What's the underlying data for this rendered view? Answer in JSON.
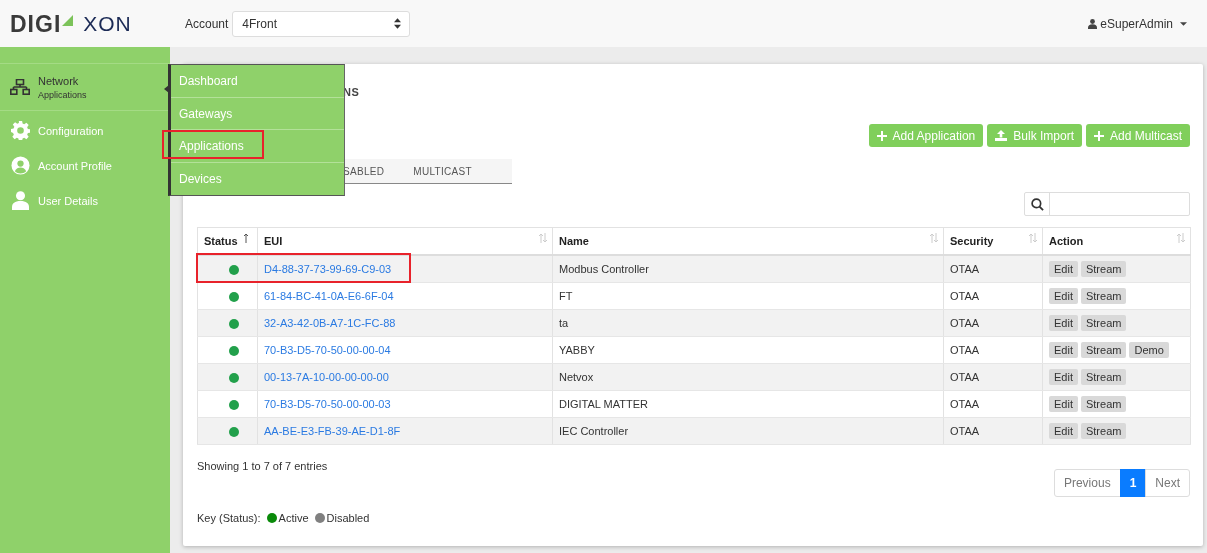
{
  "header": {
    "logo": {
      "left": "DIGI",
      "right": "XON"
    },
    "account_label": "Account",
    "account_value": "4Front",
    "user": "eSuperAdmin"
  },
  "sidebar": {
    "items": [
      {
        "label": "Network",
        "sublabel": "Applications",
        "selected": true
      },
      {
        "label": "Configuration",
        "selected": false
      },
      {
        "label": "Account Profile",
        "selected": false
      },
      {
        "label": "User Details",
        "selected": false
      }
    ]
  },
  "flyout_menu": {
    "items": [
      {
        "label": "Dashboard",
        "highlighted": false
      },
      {
        "label": "Gateways",
        "highlighted": false
      },
      {
        "label": "Applications",
        "highlighted": true
      },
      {
        "label": "Devices",
        "highlighted": false
      }
    ]
  },
  "page_title": "NS",
  "buttons": [
    {
      "label": "Add Application"
    },
    {
      "label": "Bulk Import"
    },
    {
      "label": "Add Multicast"
    }
  ],
  "tabs": [
    {
      "label": "SABLED",
      "selected": false
    },
    {
      "label": "MULTICAST",
      "selected": false
    }
  ],
  "table": {
    "columns": [
      {
        "label": "Status",
        "sorted": true
      },
      {
        "label": "EUI",
        "sorted": false
      },
      {
        "label": "Name",
        "sorted": false
      },
      {
        "label": "Security",
        "sorted": false
      },
      {
        "label": "Action",
        "sorted": false
      }
    ],
    "rows": [
      {
        "color": "#22a04b",
        "eui": "D4-88-37-73-99-69-C9-03",
        "name": "Modbus Controller",
        "security": "OTAA",
        "actions": [
          "Edit",
          "Stream"
        ],
        "highlighted": true
      },
      {
        "color": "#22a04b",
        "eui": "61-84-BC-41-0A-E6-6F-04",
        "name": "FT",
        "security": "OTAA",
        "actions": [
          "Edit",
          "Stream"
        ],
        "highlighted": false
      },
      {
        "color": "#22a04b",
        "eui": "32-A3-42-0B-A7-1C-FC-88",
        "name": "ta",
        "security": "OTAA",
        "actions": [
          "Edit",
          "Stream"
        ],
        "highlighted": false
      },
      {
        "color": "#22a04b",
        "eui": "70-B3-D5-70-50-00-00-04",
        "name": "YABBY",
        "security": "OTAA",
        "actions": [
          "Edit",
          "Stream",
          "Demo"
        ],
        "highlighted": false
      },
      {
        "color": "#22a04b",
        "eui": "00-13-7A-10-00-00-00-00",
        "name": "Netvox",
        "security": "OTAA",
        "actions": [
          "Edit",
          "Stream"
        ],
        "highlighted": false
      },
      {
        "color": "#22a04b",
        "eui": "70-B3-D5-70-50-00-00-03",
        "name": "DIGITAL MATTER",
        "security": "OTAA",
        "actions": [
          "Edit",
          "Stream"
        ],
        "highlighted": false
      },
      {
        "color": "#22a04b",
        "eui": "AA-BE-E3-FB-39-AE-D1-8F",
        "name": "IEC Controller",
        "security": "OTAA",
        "actions": [
          "Edit",
          "Stream"
        ],
        "highlighted": false
      }
    ]
  },
  "summary": "Showing 1 to 7 of 7 entries",
  "pagination": [
    {
      "label": "Previous",
      "selected": false
    },
    {
      "label": "1",
      "selected": true
    },
    {
      "label": "Next",
      "selected": false
    }
  ],
  "key": {
    "label": "Key (Status):",
    "items": [
      {
        "label": "Active",
        "color": "#0a8a0a"
      },
      {
        "label": "Disabled",
        "color": "#808080"
      }
    ]
  }
}
